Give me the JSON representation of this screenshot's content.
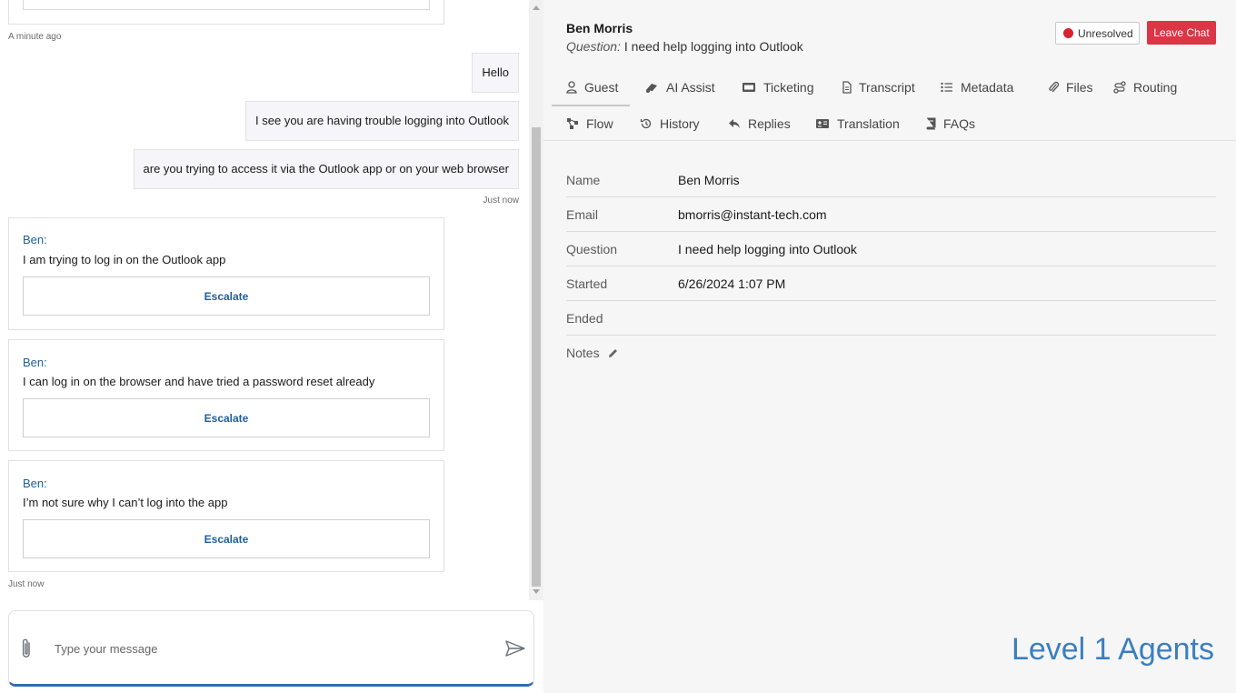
{
  "chat": {
    "ts_top": "A minute ago",
    "agent_messages": [
      "Hello",
      "I see you are having trouble logging into Outlook",
      "are you trying to access it via the Outlook app or on your web browser"
    ],
    "ts_agent": "Just now",
    "guest_messages": [
      {
        "sender": "Ben:",
        "text": "I am trying to log in on the Outlook app",
        "button": "Escalate"
      },
      {
        "sender": "Ben:",
        "text": "I can log in on the browser and have tried a password reset already",
        "button": "Escalate"
      },
      {
        "sender": "Ben:",
        "text": "I’m not sure why I can’t log into the app",
        "button": "Escalate"
      }
    ],
    "ts_bottom": "Just now",
    "composer": {
      "placeholder": "Type your message"
    }
  },
  "header": {
    "name": "Ben Morris",
    "question_label": "Question:",
    "question": "I need help logging into Outlook",
    "status_label": "Unresolved",
    "status_color": "#d8232f",
    "leave_label": "Leave Chat",
    "leave_color": "#dc3545"
  },
  "tabs": [
    {
      "label": "Guest",
      "icon": "user-icon",
      "active": true
    },
    {
      "label": "AI Assist",
      "icon": "ai-icon"
    },
    {
      "label": "Ticketing",
      "icon": "ticket-icon"
    },
    {
      "label": "Transcript",
      "icon": "document-icon"
    },
    {
      "label": "Metadata",
      "icon": "list-icon"
    },
    {
      "label": "Files",
      "icon": "paperclip-icon"
    },
    {
      "label": "Routing",
      "icon": "route-icon"
    },
    {
      "label": "Flow",
      "icon": "flow-icon"
    },
    {
      "label": "History",
      "icon": "history-icon"
    },
    {
      "label": "Replies",
      "icon": "reply-icon"
    },
    {
      "label": "Translation",
      "icon": "id-card-icon"
    },
    {
      "label": "FAQs",
      "icon": "book-icon"
    }
  ],
  "guest_info": [
    {
      "key": "Name",
      "value": "Ben Morris"
    },
    {
      "key": "Email",
      "value": "bmorris@instant-tech.com"
    },
    {
      "key": "Question",
      "value": "I need help logging into Outlook"
    },
    {
      "key": "Started",
      "value": "6/26/2024 1:07 PM"
    },
    {
      "key": "Ended",
      "value": ""
    },
    {
      "key": "Notes",
      "value": ""
    }
  ],
  "brand": {
    "text": "Level 1 Agents",
    "color": "#3b7fc0"
  }
}
